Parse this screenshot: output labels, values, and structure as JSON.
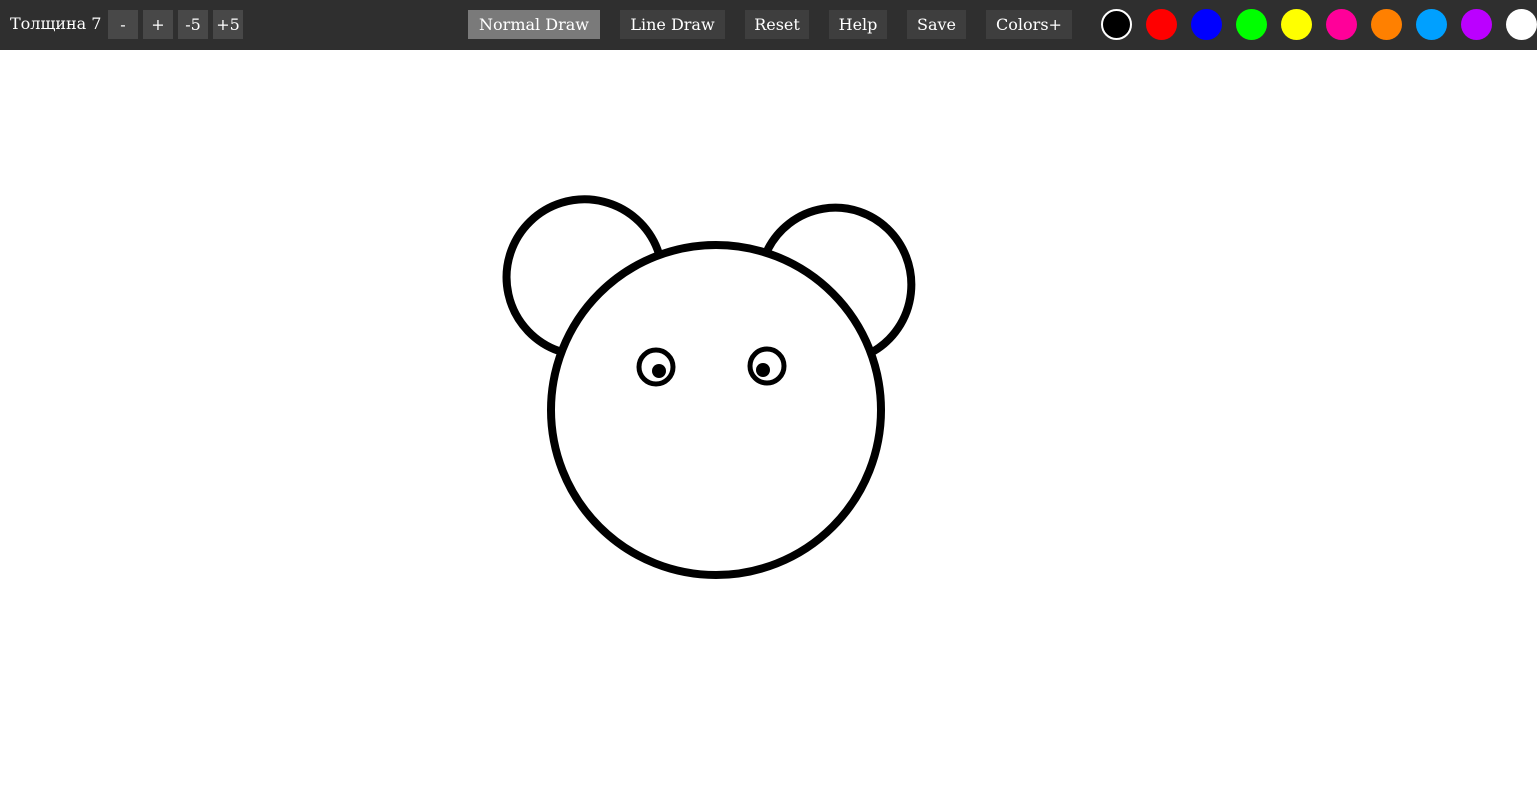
{
  "toolbar": {
    "thickness_label": "Толщина 7",
    "buttons": {
      "minus": "-",
      "plus": "+",
      "minus5": "-5",
      "plus5": "+5"
    },
    "modes": {
      "normal_draw": "Normal Draw",
      "line_draw": "Line Draw"
    },
    "actions": {
      "reset": "Reset",
      "help": "Help",
      "save": "Save",
      "colors_plus": "Colors+"
    },
    "palette": [
      {
        "name": "black",
        "color": "#000000",
        "selected": true
      },
      {
        "name": "red",
        "color": "#ff0000"
      },
      {
        "name": "blue",
        "color": "#0000ff"
      },
      {
        "name": "green",
        "color": "#00ff00"
      },
      {
        "name": "yellow",
        "color": "#ffff00"
      },
      {
        "name": "pink",
        "color": "#ff0099"
      },
      {
        "name": "orange",
        "color": "#ff8000"
      },
      {
        "name": "sky-blue",
        "color": "#00a0ff"
      },
      {
        "name": "purple",
        "color": "#bb00ff"
      },
      {
        "name": "white",
        "color": "#ffffff"
      }
    ]
  },
  "canvas": {
    "background": "#ffffff",
    "stroke_color": "#000000",
    "drawing": "bear-face"
  }
}
